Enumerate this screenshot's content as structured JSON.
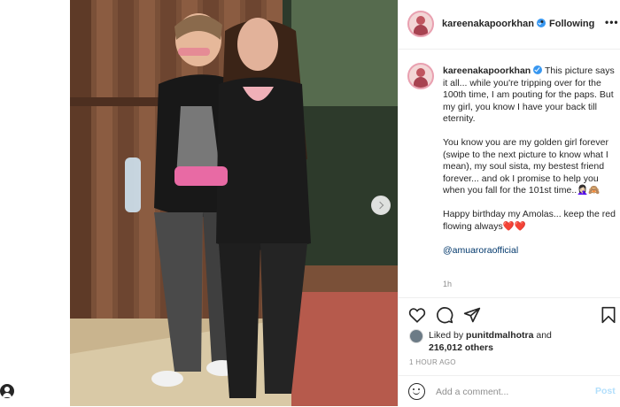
{
  "post": {
    "photo_alt": "photo of two women walking",
    "carousel_next_icon": "chevron-right-icon"
  },
  "header": {
    "username": "kareenakapoorkhan",
    "separator": "•",
    "follow_status": "Following",
    "more_label": "•••"
  },
  "caption": {
    "username": "kareenakapoorkhan",
    "paragraphs": [
      "This picture says it all... while you're tripping over for the 100th time, I am pouting for the paps. But my girl, you know I have your back till eternity.",
      "You know you are my golden girl forever (swipe to the next picture to know what I mean), my soul sista, my bestest friend forever... and ok I promise to help you when you fall for the 101st time..🤦🏻‍♀️🙈",
      "Happy birthday my Amolas... keep the red flowing always❤️❤️"
    ],
    "mention": "@amuaroraofficial",
    "age": "1h"
  },
  "actions": {
    "like_icon": "heart-icon",
    "comment_icon": "comment-icon",
    "share_icon": "share-icon",
    "save_icon": "bookmark-icon"
  },
  "likes": {
    "prefix": "Liked by ",
    "user": "punitdmalhotra",
    "and": " and",
    "count": "216,012 others"
  },
  "timestamp": "1 HOUR AGO",
  "comment_box": {
    "placeholder": "Add a comment...",
    "post_label": "Post"
  },
  "colors": {
    "accent": "#3897f0",
    "post_disabled": "#b2dffc",
    "mention": "#00376b"
  }
}
